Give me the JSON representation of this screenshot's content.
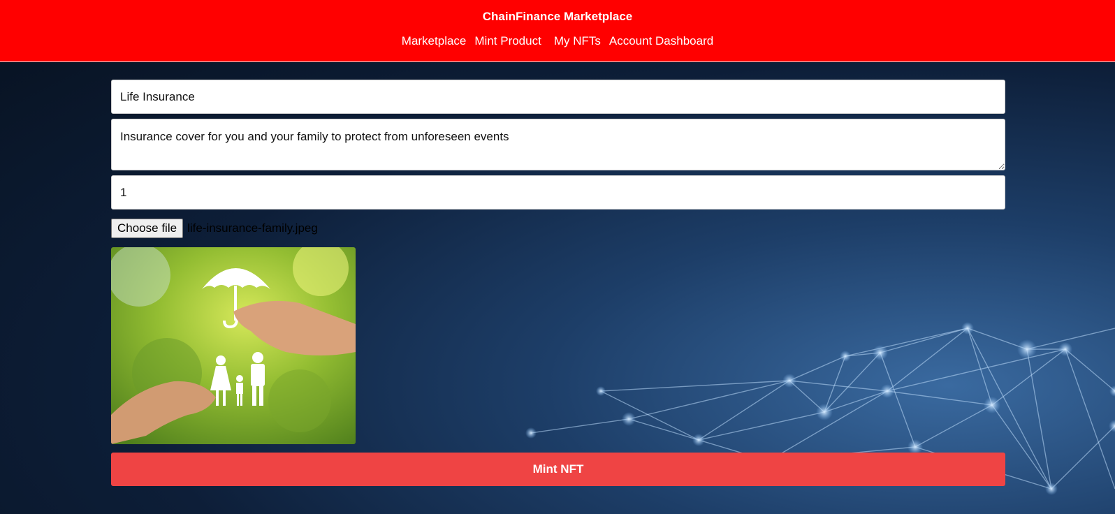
{
  "header": {
    "brand": "ChainFinance Marketplace",
    "nav": [
      "Marketplace",
      "Mint Product",
      "My NFTs",
      "Account Dashboard"
    ],
    "color": "#ff0000"
  },
  "form": {
    "name_value": "Life Insurance",
    "description_value": "Insurance cover for you and your family to protect from unforeseen events",
    "price_value": "1",
    "choose_file_label": "Choose file",
    "file_name": "life-insurance-family.jpeg",
    "submit_label": "Mint NFT",
    "submit_color": "#ef4444"
  },
  "icons": [
    "umbrella-icon",
    "family-icon"
  ]
}
